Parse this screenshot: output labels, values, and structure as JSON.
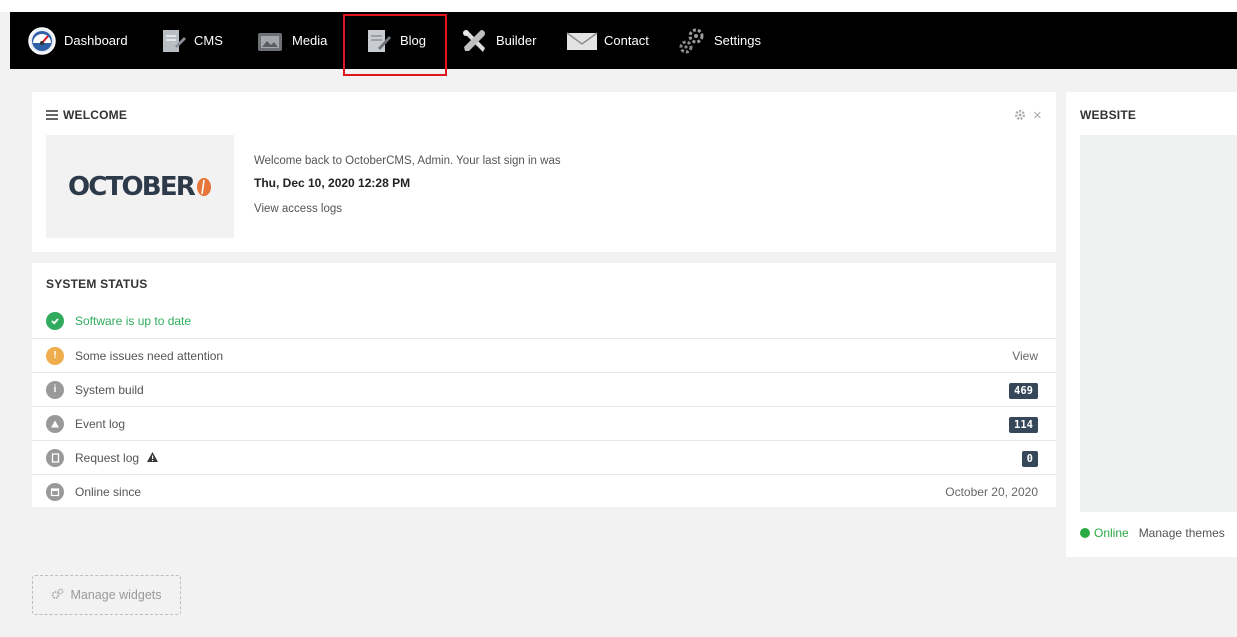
{
  "nav": {
    "items": [
      {
        "label": "Dashboard",
        "icon": "dashboard-gauge-icon"
      },
      {
        "label": "CMS",
        "icon": "cms-pages-icon"
      },
      {
        "label": "Media",
        "icon": "media-folder-icon"
      },
      {
        "label": "Blog",
        "icon": "blog-document-icon"
      },
      {
        "label": "Builder",
        "icon": "builder-tools-icon"
      },
      {
        "label": "Contact",
        "icon": "contact-envelope-icon"
      },
      {
        "label": "Settings",
        "icon": "settings-gears-icon"
      }
    ],
    "highlighted": "Blog"
  },
  "welcome": {
    "title": "WELCOME",
    "logo_text": "OCTOBER",
    "message": "Welcome back to OctoberCMS, Admin. Your last sign in was",
    "last_signin": "Thu, Dec 10, 2020 12:28 PM",
    "access_logs_link": "View access logs"
  },
  "status": {
    "title": "SYSTEM STATUS",
    "rows": [
      {
        "label": "Software is up to date",
        "icon": "check-circle-icon",
        "color": "#31ac5f",
        "value": ""
      },
      {
        "label": "Some issues need attention",
        "icon": "warning-circle-icon",
        "color": "#f0ad4e",
        "value": "View"
      },
      {
        "label": "System build",
        "icon": "info-circle-icon",
        "color": "#999999",
        "value": "469"
      },
      {
        "label": "Event log",
        "icon": "event-log-icon",
        "color": "#999999",
        "value": "114"
      },
      {
        "label": "Request log",
        "icon": "request-log-icon",
        "color": "#999999",
        "value": "0"
      },
      {
        "label": "Online since",
        "icon": "calendar-icon",
        "color": "#999999",
        "value": "October 20, 2020"
      }
    ]
  },
  "website": {
    "title": "WEBSITE",
    "online_label": "Online",
    "manage_themes": "Manage themes"
  },
  "manage_widgets_label": "Manage widgets",
  "colors": {
    "navbar_bg": "#000000",
    "highlight_border": "#e0161c",
    "badge_bg": "#37475a",
    "online_green": "#2aaa45",
    "logo_accent": "#e8753a"
  }
}
